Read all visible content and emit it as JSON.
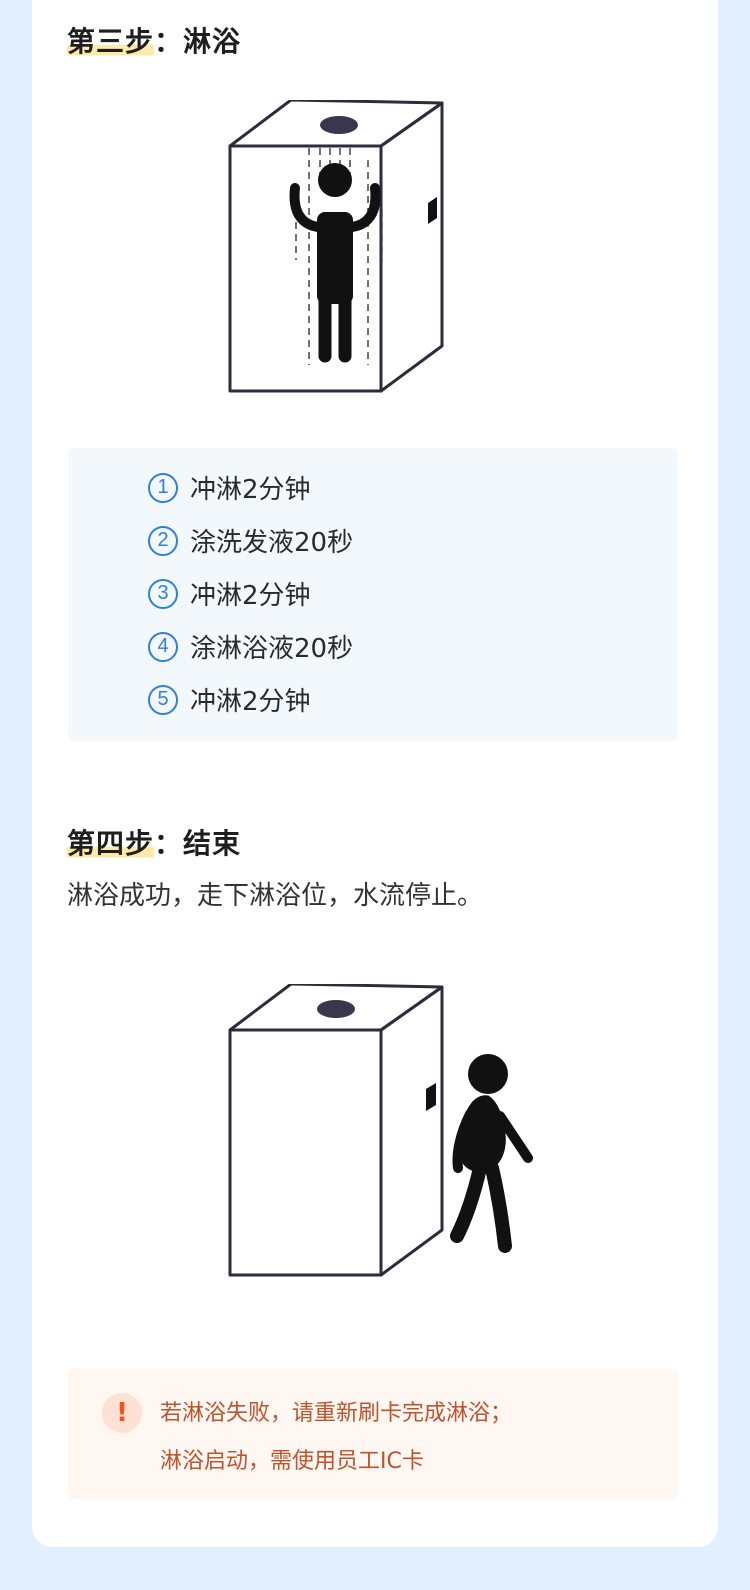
{
  "step3": {
    "title_prefix": "第三步",
    "title_rest": "：淋浴",
    "steps": [
      {
        "num": "1",
        "text": "冲淋2分钟"
      },
      {
        "num": "2",
        "text": "涂洗发液20秒"
      },
      {
        "num": "3",
        "text": "冲淋2分钟"
      },
      {
        "num": "4",
        "text": "涂淋浴液20秒"
      },
      {
        "num": "5",
        "text": "冲淋2分钟"
      }
    ]
  },
  "step4": {
    "title_prefix": "第四步",
    "title_rest": "：结束",
    "description": "淋浴成功，走下淋浴位，水流停止。"
  },
  "notice": {
    "icon": "exclamation-icon",
    "line1": "若淋浴失败，请重新刷卡完成淋浴；",
    "line2": "淋浴启动，需使用员工IC卡"
  },
  "colors": {
    "page_background": "#e2efff",
    "accent_blue": "#2f7fe0",
    "highlight_yellow": "#ffe9a8",
    "notice_text": "#c0522d",
    "notice_background": "#fff7f1"
  }
}
